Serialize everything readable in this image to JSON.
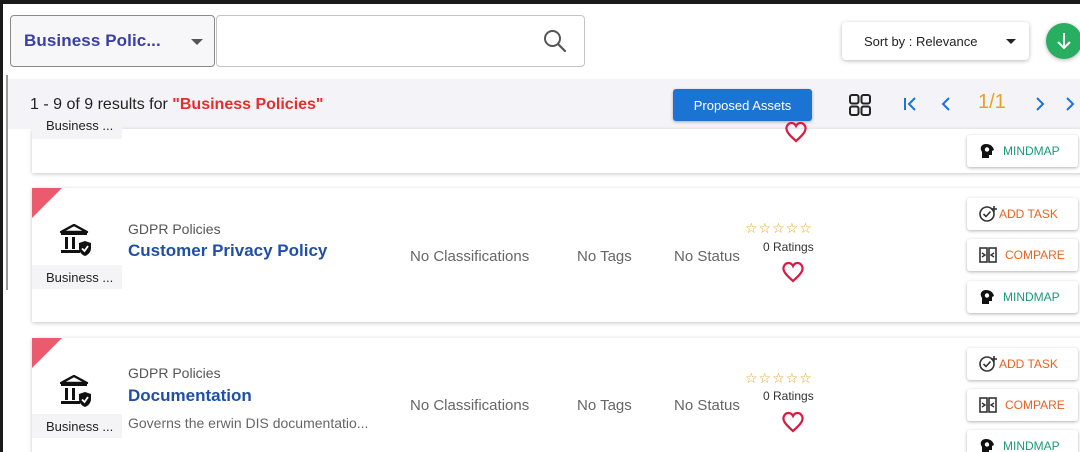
{
  "search": {
    "category_label": "Business Polic...",
    "query_value": "",
    "sort_label": "Sort by : Relevance"
  },
  "results": {
    "summary_prefix": "1 - 9 of 9 results for ",
    "query_quoted": "\"Business Policies\"",
    "proposed_assets_label": "Proposed Assets",
    "page_indicator": "1/1"
  },
  "partial_card": {
    "asset_type": "Business ...",
    "mindmap_label": "MINDMAP"
  },
  "cards": [
    {
      "category": "GDPR Policies",
      "title": "Customer Privacy Policy",
      "description": "",
      "asset_type": "Business ...",
      "classifications": "No Classifications",
      "tags": "No Tags",
      "status": "No Status",
      "stars": "☆☆☆☆☆",
      "ratings": "0 Ratings",
      "add_task_label": "ADD TASK",
      "compare_label": "COMPARE",
      "mindmap_label": "MINDMAP"
    },
    {
      "category": "GDPR Policies",
      "title": "Documentation",
      "description": "Governs the erwin DIS documentatio...",
      "asset_type": "Business ...",
      "classifications": "No Classifications",
      "tags": "No Tags",
      "status": "No Status",
      "stars": "☆☆☆☆☆",
      "ratings": "0 Ratings",
      "add_task_label": "ADD TASK",
      "compare_label": "COMPARE",
      "mindmap_label": "MINDMAP"
    }
  ],
  "colors": {
    "category_select_text": "#3a3fa5",
    "query_highlight": "#e52d2d",
    "primary_button": "#1b74d4",
    "download_button": "#27ae60",
    "pager": "#1b74d4",
    "page_number": "#e8a21f",
    "card_flag": "#ec5a6e",
    "star": "#e8a21f",
    "heart": "#d81b40",
    "task_compare": "#e8631f",
    "mindmap": "#1a9a78"
  },
  "icons": {
    "search": "search-icon",
    "download": "arrow-down-icon",
    "grid": "grid-view-icon",
    "pager": [
      "first-page-icon",
      "prev-page-icon",
      "next-page-icon",
      "last-page-icon"
    ],
    "asset": "bank-shield-icon",
    "heart": "heart-icon",
    "add_task": "check-plus-icon",
    "compare": "compare-icon",
    "mindmap": "head-gear-icon"
  }
}
